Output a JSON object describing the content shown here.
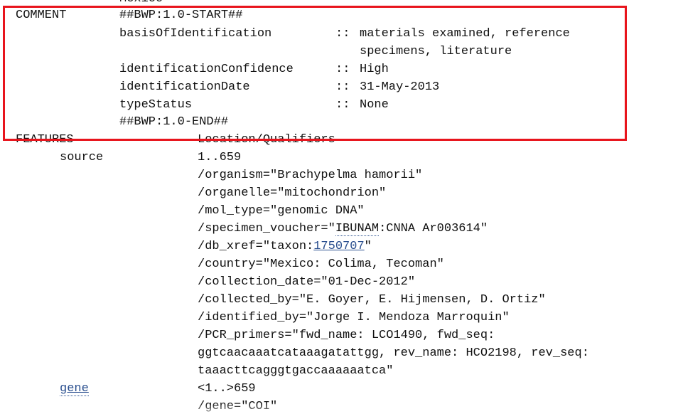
{
  "top_partial": {
    "text": "Mexico"
  },
  "comment": {
    "key": "COMMENT",
    "start": "##BWP:1.0-START##",
    "basis_key": "basisOfIdentification",
    "basis_sep": "::",
    "basis_value_1": "materials examined, reference",
    "basis_value_2": "specimens, literature",
    "confidence_key": "identificationConfidence",
    "confidence_sep": "::",
    "confidence_value": "High",
    "date_key": "identificationDate",
    "date_sep": "::",
    "date_value": "31-May-2013",
    "type_key": "typeStatus",
    "type_sep": "::",
    "type_value": "None",
    "end": "##BWP:1.0-END##"
  },
  "features": {
    "key": "FEATURES",
    "header": "Location/Qualifiers"
  },
  "source": {
    "key": "source",
    "location": "1..659",
    "organism": "/organism=\"Brachypelma hamorii\"",
    "organelle": "/organelle=\"mitochondrion\"",
    "mol_type": "/mol_type=\"genomic DNA\"",
    "voucher_prefix": "/specimen_voucher=\"",
    "voucher_link": "IBUNAM",
    "voucher_suffix": ":CNNA Ar003614\"",
    "db_xref_prefix": "/db_xref=\"taxon:",
    "db_xref_link": "1750707",
    "db_xref_suffix": "\"",
    "country": "/country=\"Mexico: Colima, Tecoman\"",
    "collection_date": "/collection_date=\"01-Dec-2012\"",
    "collected_by": "/collected_by=\"E. Goyer, E. Hijmensen, D. Ortiz\"",
    "identified_by": "/identified_by=\"Jorge I. Mendoza Marroquin\"",
    "pcr_1": "/PCR_primers=\"fwd_name: LCO1490, fwd_seq:",
    "pcr_2": "ggtcaacaaatcataaagatattgg, rev_name: HCO2198, rev_seq:",
    "pcr_3": "taaacttcagggtgaccaaaaaatca\""
  },
  "gene": {
    "key": "gene",
    "location": "<1..>659",
    "gene_qualifier": "/gene=\"COI\""
  },
  "colors": {
    "highlight": "#e8141c",
    "link": "#2a4f8f"
  }
}
